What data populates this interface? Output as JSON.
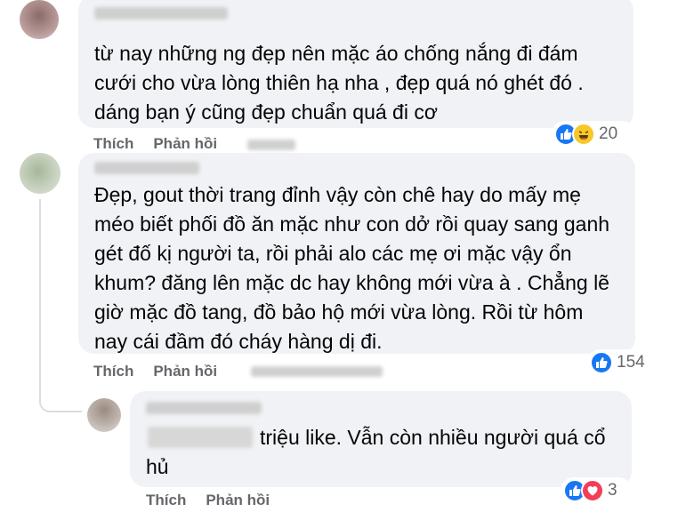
{
  "comments": [
    {
      "text_lines": [
        "từ nay những ng đẹp nên mặc áo chống nắng đi đám",
        "cưới cho vừa lòng thiên hạ nha , đẹp quá nó ghét đó .",
        "dáng bạn ý cũng đẹp chuẩn quá đi cơ"
      ],
      "like_label": "Thích",
      "reply_label": "Phản hồi",
      "reaction_icons": [
        "like-icon",
        "haha-icon"
      ],
      "reaction_count": "20"
    },
    {
      "text_lines": [
        "Đẹp, gout thời trang đỉnh vậy còn chê hay do mấy mẹ",
        "méo biết phối đồ ăn mặc như con dở rồi quay sang ganh",
        "gét đố kị người ta, rồi phải alo các mẹ ơi mặc vậy ổn",
        "khum? đăng lên mặc dc hay không mới vừa à . Chẳng lẽ",
        "giờ mặc đồ tang, đồ bảo hộ mới vừa lòng. Rồi từ hôm",
        "nay cái đầm đó cháy hàng dị đi."
      ],
      "like_label": "Thích",
      "reply_label": "Phản hồi",
      "reaction_icons": [
        "like-icon"
      ],
      "reaction_count": "154"
    },
    {
      "text_lines": [
        "triệu like. Vẫn còn nhiều người quá cổ",
        "hủ"
      ],
      "like_label": "Thích",
      "reply_label": "Phản hồi",
      "reaction_icons": [
        "like-icon",
        "love-icon"
      ],
      "reaction_count": "3"
    }
  ],
  "colors": {
    "bubble": "#f0f2f5",
    "action_text": "#65676b",
    "like_blue": "#1877f2",
    "haha_yellow": "#f7c928",
    "love_red": "#f33e58"
  }
}
